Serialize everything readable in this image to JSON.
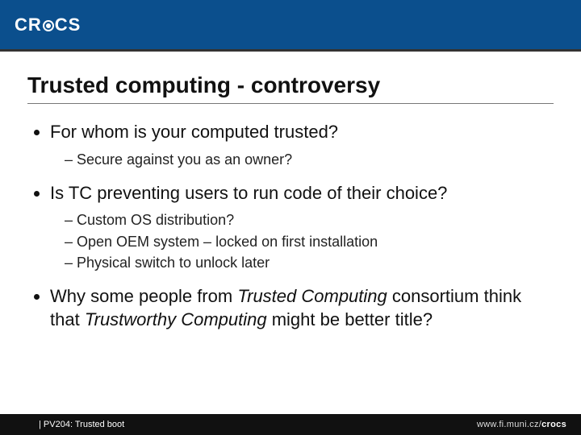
{
  "header": {
    "logo": {
      "cr": "CR",
      "cs": "CS"
    }
  },
  "title": "Trusted computing - controversy",
  "bullets": [
    {
      "text": "For whom is your computed trusted?",
      "sub": [
        "Secure against you as an owner?"
      ]
    },
    {
      "text": "Is TC preventing users to run code of their choice?",
      "sub": [
        "Custom OS distribution?",
        "Open OEM system – locked on first installation",
        "Physical switch to unlock later"
      ]
    },
    {
      "seg1": "Why some people from ",
      "em1": "Trusted Computing",
      "seg2": " consortium think that ",
      "em2": "Trustworthy Computing",
      "seg3": " might be better title?"
    }
  ],
  "footer": {
    "left": "| PV204: Trusted boot",
    "url_prefix": "www.fi.muni.cz/",
    "url_bold": "crocs"
  }
}
